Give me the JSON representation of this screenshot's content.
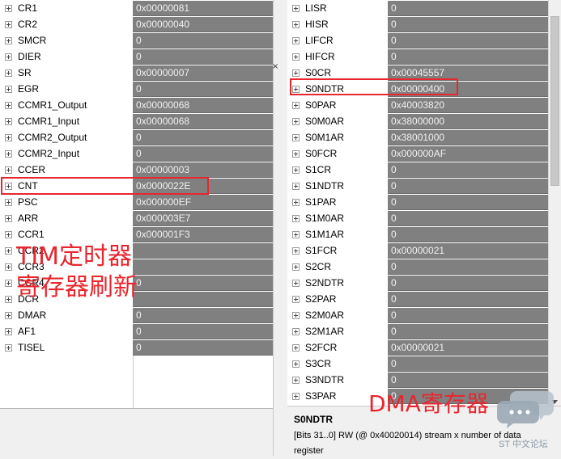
{
  "tim_panel": {
    "registers": [
      {
        "name": "CR1",
        "value": "0x00000081"
      },
      {
        "name": "CR2",
        "value": "0x00000040"
      },
      {
        "name": "SMCR",
        "value": "0"
      },
      {
        "name": "DIER",
        "value": "0"
      },
      {
        "name": "SR",
        "value": "0x00000007"
      },
      {
        "name": "EGR",
        "value": "0"
      },
      {
        "name": "CCMR1_Output",
        "value": "0x00000068"
      },
      {
        "name": "CCMR1_Input",
        "value": "0x00000068"
      },
      {
        "name": "CCMR2_Output",
        "value": "0"
      },
      {
        "name": "CCMR2_Input",
        "value": "0"
      },
      {
        "name": "CCER",
        "value": "0x00000003"
      },
      {
        "name": "CNT",
        "value": "0x0000022E"
      },
      {
        "name": "PSC",
        "value": "0x000000EF"
      },
      {
        "name": "ARR",
        "value": "0x000003E7"
      },
      {
        "name": "CCR1",
        "value": "0x000001F3"
      },
      {
        "name": "CCR2",
        "value": ""
      },
      {
        "name": "CCR3",
        "value": ""
      },
      {
        "name": "CCR4",
        "value": "0"
      },
      {
        "name": "DCR",
        "value": ""
      },
      {
        "name": "DMAR",
        "value": "0"
      },
      {
        "name": "AF1",
        "value": "0"
      },
      {
        "name": "TISEL",
        "value": "0"
      }
    ],
    "annotation_line1": "TIM定时器",
    "annotation_line2": "寄存器刷新"
  },
  "dma_panel": {
    "registers": [
      {
        "name": "LISR",
        "value": "0"
      },
      {
        "name": "HISR",
        "value": "0"
      },
      {
        "name": "LIFCR",
        "value": "0"
      },
      {
        "name": "HIFCR",
        "value": "0"
      },
      {
        "name": "S0CR",
        "value": "0x00045557"
      },
      {
        "name": "S0NDTR",
        "value": "0x00000400"
      },
      {
        "name": "S0PAR",
        "value": "0x40003820"
      },
      {
        "name": "S0M0AR",
        "value": "0x38000000"
      },
      {
        "name": "S0M1AR",
        "value": "0x38001000"
      },
      {
        "name": "S0FCR",
        "value": "0x000000AF"
      },
      {
        "name": "S1CR",
        "value": "0"
      },
      {
        "name": "S1NDTR",
        "value": "0"
      },
      {
        "name": "S1PAR",
        "value": "0"
      },
      {
        "name": "S1M0AR",
        "value": "0"
      },
      {
        "name": "S1M1AR",
        "value": "0"
      },
      {
        "name": "S1FCR",
        "value": "0x00000021"
      },
      {
        "name": "S2CR",
        "value": "0"
      },
      {
        "name": "S2NDTR",
        "value": "0"
      },
      {
        "name": "S2PAR",
        "value": "0"
      },
      {
        "name": "S2M0AR",
        "value": "0"
      },
      {
        "name": "S2M1AR",
        "value": "0"
      },
      {
        "name": "S2FCR",
        "value": "0x00000021"
      },
      {
        "name": "S3CR",
        "value": "0"
      },
      {
        "name": "S3NDTR",
        "value": "0"
      },
      {
        "name": "S3PAR",
        "value": "0"
      }
    ],
    "annotation": "DMA寄存器",
    "info": {
      "title": "S0NDTR",
      "description": "[Bits 31..0] RW (@ 0x40020014) stream x number of data register"
    }
  },
  "watermark": {
    "text": "ST 中文论坛"
  },
  "colors": {
    "value_bg": "#808080",
    "highlight": "#e8262e"
  }
}
